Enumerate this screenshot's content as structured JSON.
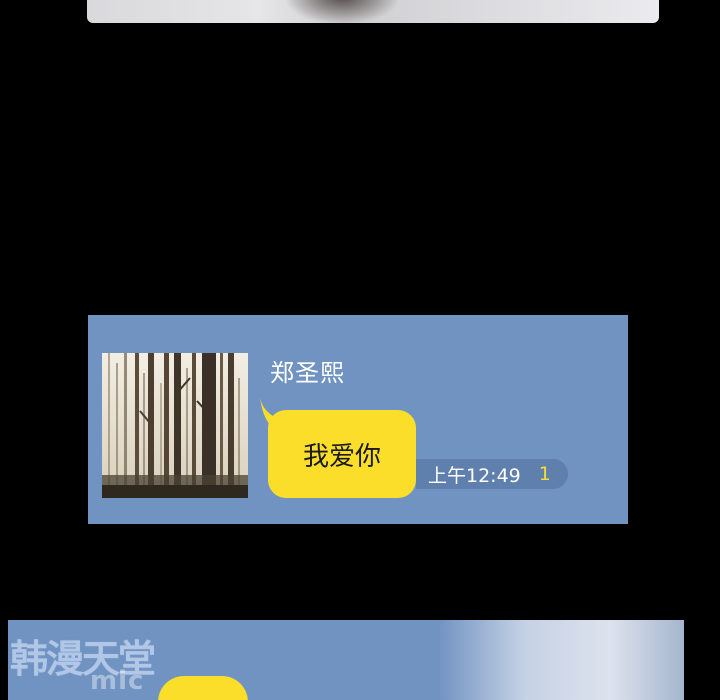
{
  "chat": {
    "sender_name": "郑圣熙",
    "message": "我爱你",
    "time": "上午12:49",
    "read_count": "1"
  },
  "watermark": {
    "main": "韩漫天堂",
    "sub": "mic"
  },
  "colors": {
    "panel_bg": "#7093c2",
    "bubble": "#fbde2a",
    "time_pill": "#5f7fad",
    "read_count": "#f5dd38",
    "background": "#000000"
  },
  "icons": {
    "avatar": "forest-photo"
  }
}
